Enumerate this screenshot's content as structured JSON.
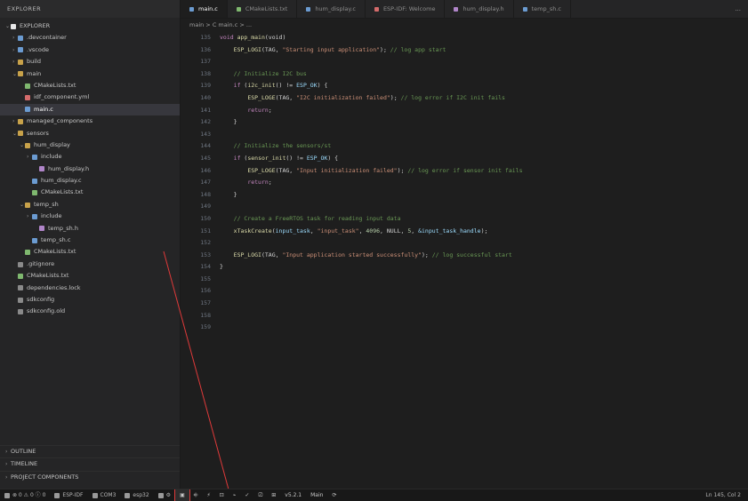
{
  "sidebar": {
    "header": "EXPLORER",
    "items": [
      {
        "label": "EXPLORER",
        "depth": 0,
        "chevron": "v",
        "color": "#e8e8e8"
      },
      {
        "label": ".devcontainer",
        "depth": 1,
        "chevron": ">",
        "color": "#6b9bd1"
      },
      {
        "label": ".vscode",
        "depth": 1,
        "chevron": ">",
        "color": "#6b9bd1"
      },
      {
        "label": "build",
        "depth": 1,
        "chevron": ">",
        "color": "#c8a24a"
      },
      {
        "label": "main",
        "depth": 1,
        "chevron": "v",
        "color": "#c8a24a"
      },
      {
        "label": "CMakeLists.txt",
        "depth": 2,
        "chevron": "",
        "color": "#7fb86f"
      },
      {
        "label": "idf_component.yml",
        "depth": 2,
        "chevron": "",
        "color": "#d46b6b"
      },
      {
        "label": "main.c",
        "depth": 2,
        "chevron": "",
        "color": "#6b9bd1",
        "selected": true
      },
      {
        "label": "managed_components",
        "depth": 1,
        "chevron": ">",
        "color": "#c8a24a"
      },
      {
        "label": "sensors",
        "depth": 1,
        "chevron": "v",
        "color": "#c8a24a"
      },
      {
        "label": "hum_display",
        "depth": 2,
        "chevron": "v",
        "color": "#c8a24a"
      },
      {
        "label": "include",
        "depth": 3,
        "chevron": ">",
        "color": "#6b9bd1"
      },
      {
        "label": "hum_display.h",
        "depth": 4,
        "chevron": "",
        "color": "#b085c9"
      },
      {
        "label": "hum_display.c",
        "depth": 3,
        "chevron": "",
        "color": "#6b9bd1"
      },
      {
        "label": "CMakeLists.txt",
        "depth": 3,
        "chevron": "",
        "color": "#7fb86f"
      },
      {
        "label": "temp_sh",
        "depth": 2,
        "chevron": "v",
        "color": "#c8a24a"
      },
      {
        "label": "include",
        "depth": 3,
        "chevron": ">",
        "color": "#6b9bd1"
      },
      {
        "label": "temp_sh.h",
        "depth": 4,
        "chevron": "",
        "color": "#b085c9"
      },
      {
        "label": "temp_sh.c",
        "depth": 3,
        "chevron": "",
        "color": "#6b9bd1"
      },
      {
        "label": "CMakeLists.txt",
        "depth": 2,
        "chevron": "",
        "color": "#7fb86f"
      },
      {
        "label": ".gitignore",
        "depth": 1,
        "chevron": "",
        "color": "#8a8a8a"
      },
      {
        "label": "CMakeLists.txt",
        "depth": 1,
        "chevron": "",
        "color": "#7fb86f"
      },
      {
        "label": "dependencies.lock",
        "depth": 1,
        "chevron": "",
        "color": "#8a8a8a"
      },
      {
        "label": "sdkconfig",
        "depth": 1,
        "chevron": "",
        "color": "#8a8a8a"
      },
      {
        "label": "sdkconfig.old",
        "depth": 1,
        "chevron": "",
        "color": "#8a8a8a"
      }
    ],
    "footer": [
      {
        "label": "OUTLINE"
      },
      {
        "label": "TIMELINE"
      },
      {
        "label": "PROJECT COMPONENTS"
      }
    ]
  },
  "tabs": [
    {
      "label": "main.c",
      "active": true,
      "color": "#6b9bd1"
    },
    {
      "label": "CMakeLists.txt",
      "active": false,
      "color": "#7fb86f"
    },
    {
      "label": "hum_display.c",
      "active": false,
      "color": "#6b9bd1"
    },
    {
      "label": "ESP-IDF: Welcome",
      "active": false,
      "color": "#d46b6b"
    },
    {
      "label": "hum_display.h",
      "active": false,
      "color": "#b085c9"
    },
    {
      "label": "temp_sh.c",
      "active": false,
      "color": "#6b9bd1"
    }
  ],
  "tab_overflow": "...",
  "breadcrumb": "main > C main.c > ...",
  "editor": {
    "line_numbers": [
      "135",
      "136",
      "137",
      "138",
      "139",
      "140",
      "141",
      "142",
      "143",
      "144",
      "145",
      "146",
      "147",
      "148",
      "149",
      "150",
      "151",
      "152",
      "153",
      "154",
      "155",
      "156",
      "157",
      "158",
      "159"
    ],
    "lines": [
      [
        {
          "t": "void ",
          "c": "kw"
        },
        {
          "t": "app_main",
          "c": "fn"
        },
        {
          "t": "(void)",
          "c": "pl"
        }
      ],
      [
        {
          "t": "    ",
          "c": "pl"
        },
        {
          "t": "ESP_LOGI",
          "c": "fn"
        },
        {
          "t": "(TAG, ",
          "c": "pl"
        },
        {
          "t": "\"Starting input application\"",
          "c": "str"
        },
        {
          "t": "); ",
          "c": "pl"
        },
        {
          "t": "// log app start",
          "c": "cm"
        }
      ],
      [],
      [
        {
          "t": "    ",
          "c": "pl"
        },
        {
          "t": "// Initialize I2C bus",
          "c": "cm"
        }
      ],
      [
        {
          "t": "    ",
          "c": "pl"
        },
        {
          "t": "if ",
          "c": "kw"
        },
        {
          "t": "(",
          "c": "pl"
        },
        {
          "t": "i2c_init",
          "c": "fn"
        },
        {
          "t": "() != ",
          "c": "pl"
        },
        {
          "t": "ESP_OK",
          "c": "var"
        },
        {
          "t": ") {",
          "c": "pl"
        }
      ],
      [
        {
          "t": "        ",
          "c": "pl"
        },
        {
          "t": "ESP_LOGE",
          "c": "fn"
        },
        {
          "t": "(TAG, ",
          "c": "pl"
        },
        {
          "t": "\"I2C initialization failed\"",
          "c": "str"
        },
        {
          "t": "); ",
          "c": "pl"
        },
        {
          "t": "// log error if I2C init fails",
          "c": "cm"
        }
      ],
      [
        {
          "t": "        ",
          "c": "pl"
        },
        {
          "t": "return",
          "c": "kw"
        },
        {
          "t": ";",
          "c": "pl"
        }
      ],
      [
        {
          "t": "    }",
          "c": "pl"
        }
      ],
      [],
      [
        {
          "t": "    ",
          "c": "pl"
        },
        {
          "t": "// Initialize the sensors/st",
          "c": "cm"
        }
      ],
      [
        {
          "t": "    ",
          "c": "pl"
        },
        {
          "t": "if ",
          "c": "kw"
        },
        {
          "t": "(",
          "c": "pl"
        },
        {
          "t": "sensor_init",
          "c": "fn"
        },
        {
          "t": "() != ",
          "c": "pl"
        },
        {
          "t": "ESP_OK",
          "c": "var"
        },
        {
          "t": ") {",
          "c": "pl"
        }
      ],
      [
        {
          "t": "        ",
          "c": "pl"
        },
        {
          "t": "ESP_LOGE",
          "c": "fn"
        },
        {
          "t": "(TAG, ",
          "c": "pl"
        },
        {
          "t": "\"Input initialization failed\"",
          "c": "str"
        },
        {
          "t": "); ",
          "c": "pl"
        },
        {
          "t": "// log error if sensor init fails",
          "c": "cm"
        }
      ],
      [
        {
          "t": "        ",
          "c": "pl"
        },
        {
          "t": "return",
          "c": "kw"
        },
        {
          "t": ";",
          "c": "pl"
        }
      ],
      [
        {
          "t": "    }",
          "c": "pl"
        }
      ],
      [],
      [
        {
          "t": "    ",
          "c": "pl"
        },
        {
          "t": "// Create a FreeRTOS task for reading input data",
          "c": "cm"
        }
      ],
      [
        {
          "t": "    ",
          "c": "pl"
        },
        {
          "t": "xTaskCreate",
          "c": "fn"
        },
        {
          "t": "(",
          "c": "pl"
        },
        {
          "t": "input_task",
          "c": "var"
        },
        {
          "t": ", ",
          "c": "pl"
        },
        {
          "t": "\"input_task\"",
          "c": "str"
        },
        {
          "t": ", ",
          "c": "pl"
        },
        {
          "t": "4096",
          "c": "num"
        },
        {
          "t": ", NULL, ",
          "c": "pl"
        },
        {
          "t": "5",
          "c": "num"
        },
        {
          "t": ", ",
          "c": "pl"
        },
        {
          "t": "&input_task_handle",
          "c": "var"
        },
        {
          "t": ");",
          "c": "pl"
        }
      ],
      [],
      [
        {
          "t": "    ",
          "c": "pl"
        },
        {
          "t": "ESP_LOGI",
          "c": "fn"
        },
        {
          "t": "(TAG, ",
          "c": "pl"
        },
        {
          "t": "\"Input application started successfully\"",
          "c": "str"
        },
        {
          "t": "); ",
          "c": "pl"
        },
        {
          "t": "// log successful start",
          "c": "cm"
        }
      ],
      [
        {
          "t": "}",
          "c": "pl"
        }
      ],
      []
    ]
  },
  "statusbar": {
    "left": [
      {
        "label": "⊗ 0 ⚠ 0 ⓘ 0",
        "icon": "problems-icon"
      },
      {
        "label": "ESP-IDF",
        "icon": "esp-idf-icon"
      },
      {
        "label": "COM3",
        "icon": "port-icon"
      },
      {
        "label": "esp32",
        "icon": "chip-icon"
      },
      {
        "label": "⚙",
        "icon": "settings-icon"
      }
    ],
    "tools": [
      {
        "label": "▣",
        "name": "target-device-button",
        "highlight": true
      },
      {
        "label": "⎆",
        "name": "build-button"
      },
      {
        "label": "⚡",
        "name": "flash-button"
      },
      {
        "label": "⊡",
        "name": "monitor-button"
      },
      {
        "label": "⌁",
        "name": "menuconfig-button"
      },
      {
        "label": "✓",
        "name": "build-flash-monitor-button"
      },
      {
        "label": "⎚",
        "name": "clean-button"
      },
      {
        "label": "⊞",
        "name": "size-button"
      },
      {
        "label": "v5.2.1",
        "name": "idf-version-label"
      },
      {
        "label": "Main",
        "name": "branch-label"
      },
      {
        "label": "⟳",
        "name": "sync-button"
      }
    ],
    "right": "Ln 145, Col 2"
  }
}
